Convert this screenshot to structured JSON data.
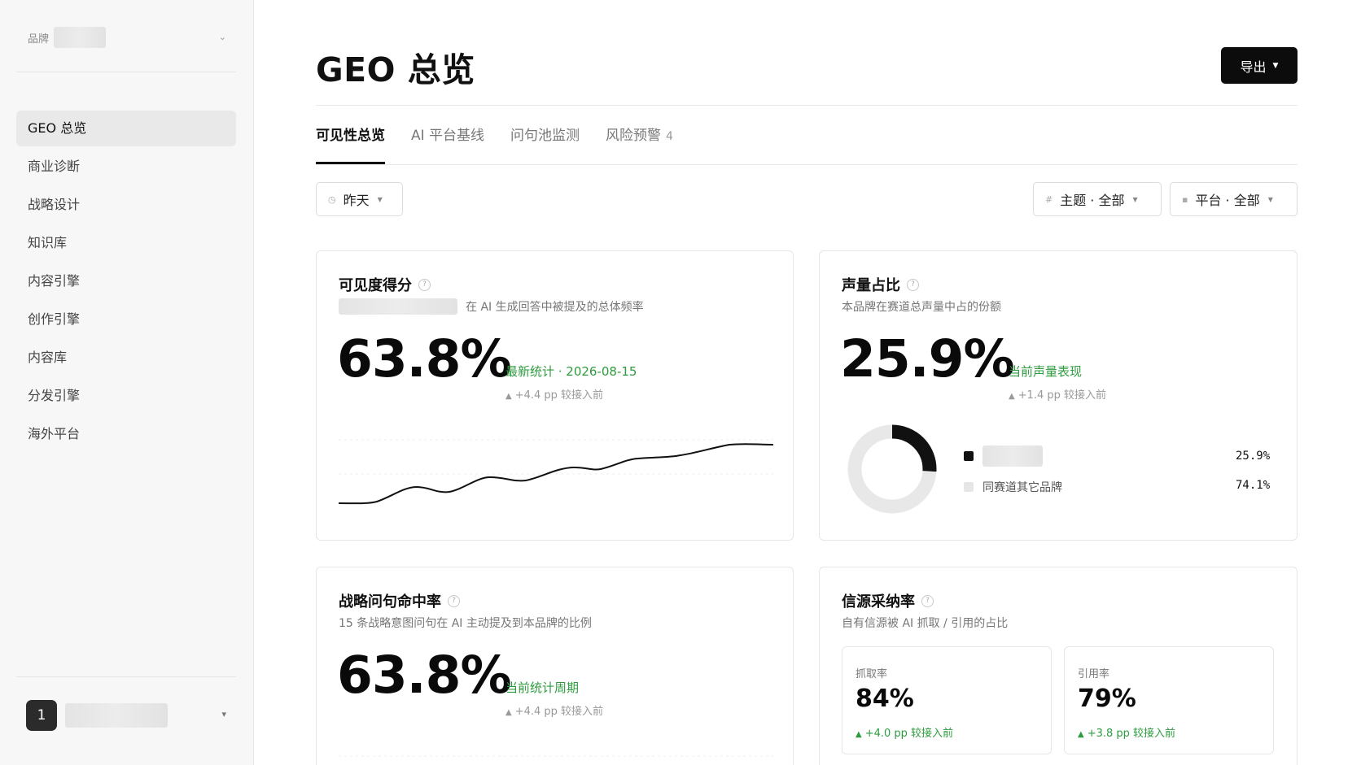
{
  "sidebar": {
    "brand_label": "品牌",
    "items": [
      {
        "label": "GEO 总览",
        "active": true
      },
      {
        "label": "商业诊断"
      },
      {
        "label": "战略设计"
      },
      {
        "label": "知识库"
      },
      {
        "label": "内容引擎"
      },
      {
        "label": "创作引擎"
      },
      {
        "label": "内容库"
      },
      {
        "label": "分发引擎"
      },
      {
        "label": "海外平台"
      }
    ],
    "user_avatar": "1"
  },
  "header": {
    "title": "GEO 总览",
    "export_label": "导出"
  },
  "tabs": [
    {
      "label": "可见性总览",
      "active": true
    },
    {
      "label": "AI 平台基线"
    },
    {
      "label": "问句池监测"
    },
    {
      "label": "风险预警",
      "count": "4"
    }
  ],
  "filters": {
    "date": "昨天",
    "topic": "主题 · 全部",
    "platform": "平台 · 全部"
  },
  "cards": {
    "visibility": {
      "title": "可见度得分",
      "subtitle": "在 AI 生成回答中被提及的总体频率",
      "value": "63.8%",
      "status": "最新统计 · 2026-08-15",
      "delta": "+4.4 pp 较接入前"
    },
    "share_of_voice": {
      "title": "声量占比",
      "subtitle": "本品牌在赛道总声量中占的份额",
      "value": "25.9%",
      "status": "当前声量表现",
      "delta": "+1.4 pp 较接入前",
      "legend": [
        {
          "label": "",
          "value": "25.9%",
          "color": "#111111"
        },
        {
          "label": "同赛道其它品牌",
          "value": "74.1%",
          "color": "#e6e6e6"
        }
      ]
    },
    "hit_rate": {
      "title": "战略问句命中率",
      "subtitle": "15 条战略意图问句在 AI 主动提及到本品牌的比例",
      "value": "63.8%",
      "status": "当前统计周期",
      "delta": "+4.4 pp 较接入前"
    },
    "source_adoption": {
      "title": "信源采纳率",
      "subtitle": "自有信源被 AI 抓取 / 引用的占比",
      "crawl": {
        "label": "抓取率",
        "value": "84%",
        "delta": "+4.0 pp 较接入前"
      },
      "cite": {
        "label": "引用率",
        "value": "79%",
        "delta": "+3.8 pp 较接入前"
      }
    }
  },
  "colors": {
    "accent_green": "#2e9b3f",
    "primary_dark": "#0c0c0c"
  }
}
